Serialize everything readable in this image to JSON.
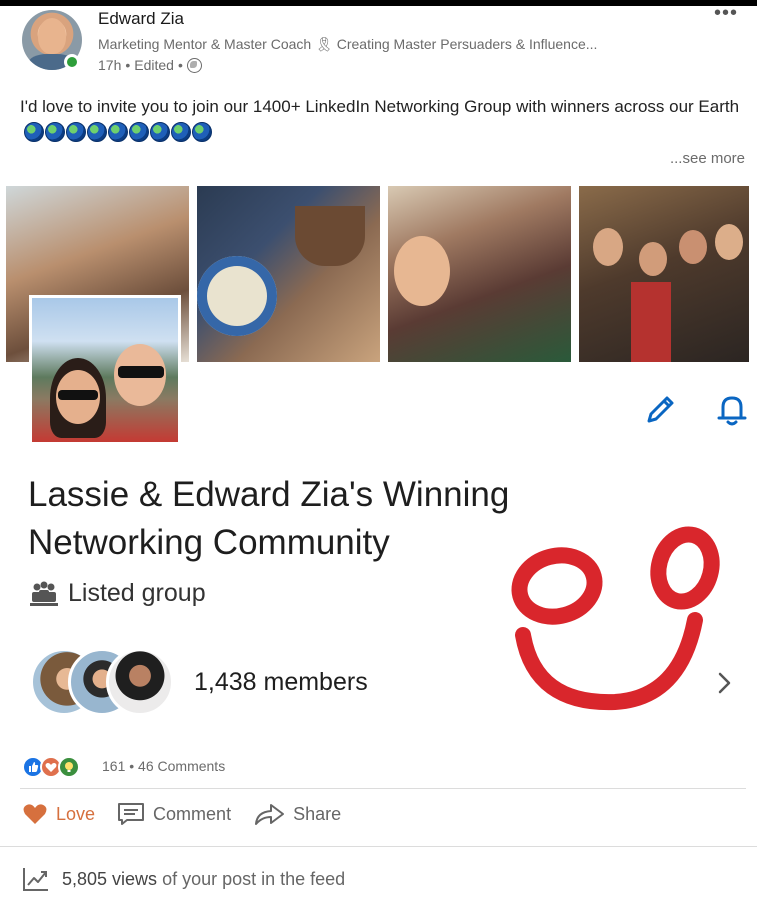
{
  "post": {
    "author_name": "Edward Zia",
    "author_headline": "Marketing Mentor & Master Coach 🎗 Creating Master Persuaders & Influence...",
    "time_ago": "17h",
    "edited": "Edited",
    "separator": "•",
    "text": "I'd love to invite you to join our 1400+ LinkedIn Networking Group with winners across our Earth",
    "emoji_count": 9,
    "see_more": "...see more",
    "icons": {
      "more": "more-options-icon",
      "visibility": "globe-icon"
    }
  },
  "group_card": {
    "title": "Lassie & Edward Zia's Winning Networking Community",
    "type": "Listed group",
    "members": "1,438 members",
    "colors": {
      "accent": "#0a66c2",
      "annotation": "#d9262c"
    },
    "icons": {
      "edit": "pencil-icon",
      "notify": "bell-icon",
      "type": "group-people-icon",
      "open": "chevron-right-icon"
    }
  },
  "social": {
    "reaction_count": "161",
    "separator": "•",
    "comments": "46 Comments",
    "reactions": [
      "like-icon",
      "love-icon",
      "insightful-icon"
    ]
  },
  "actions": {
    "love": "Love",
    "comment": "Comment",
    "share": "Share",
    "love_color": "#d6703e"
  },
  "views": {
    "count": "5,805 views",
    "suffix": " of your post in the feed",
    "icon": "analytics-chart-icon"
  }
}
